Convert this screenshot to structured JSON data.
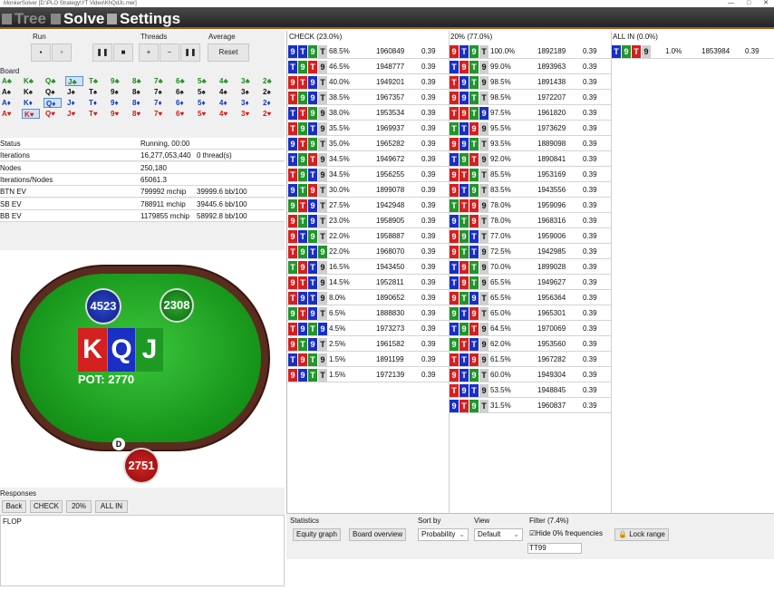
{
  "window": {
    "title": "MonkerSolver [D:\\PLO Strategy\\YT Video\\KhQdJc.mer]",
    "controls": [
      "—",
      "□",
      "✕"
    ]
  },
  "menu": [
    "Tree",
    "Solve",
    "Settings"
  ],
  "run": {
    "label": "Run",
    "threads_label": "Threads",
    "average_label": "Average",
    "reset_label": "Reset"
  },
  "board": {
    "label": "Board",
    "rows": [
      [
        [
          "A",
          "c"
        ],
        [
          "K",
          "c"
        ],
        [
          "Q",
          "c"
        ],
        [
          "J",
          "c"
        ],
        [
          "T",
          "c"
        ],
        [
          "9",
          "c"
        ],
        [
          "8",
          "c"
        ],
        [
          "7",
          "c"
        ],
        [
          "6",
          "c"
        ],
        [
          "5",
          "c"
        ],
        [
          "4",
          "c"
        ],
        [
          "3",
          "c"
        ],
        [
          "2",
          "c"
        ]
      ],
      [
        [
          "A",
          "s"
        ],
        [
          "K",
          "s"
        ],
        [
          "Q",
          "s"
        ],
        [
          "J",
          "s"
        ],
        [
          "T",
          "s"
        ],
        [
          "9",
          "s"
        ],
        [
          "8",
          "s"
        ],
        [
          "7",
          "s"
        ],
        [
          "6",
          "s"
        ],
        [
          "5",
          "s"
        ],
        [
          "4",
          "s"
        ],
        [
          "3",
          "s"
        ],
        [
          "2",
          "s"
        ]
      ],
      [
        [
          "A",
          "d"
        ],
        [
          "K",
          "d"
        ],
        [
          "Q",
          "d"
        ],
        [
          "J",
          "d"
        ],
        [
          "T",
          "d"
        ],
        [
          "9",
          "d"
        ],
        [
          "8",
          "d"
        ],
        [
          "7",
          "d"
        ],
        [
          "6",
          "d"
        ],
        [
          "5",
          "d"
        ],
        [
          "4",
          "d"
        ],
        [
          "3",
          "d"
        ],
        [
          "2",
          "d"
        ]
      ],
      [
        [
          "A",
          "h"
        ],
        [
          "K",
          "h"
        ],
        [
          "Q",
          "h"
        ],
        [
          "J",
          "h"
        ],
        [
          "T",
          "h"
        ],
        [
          "9",
          "h"
        ],
        [
          "8",
          "h"
        ],
        [
          "7",
          "h"
        ],
        [
          "6",
          "h"
        ],
        [
          "5",
          "h"
        ],
        [
          "4",
          "h"
        ],
        [
          "3",
          "h"
        ],
        [
          "2",
          "h"
        ]
      ]
    ]
  },
  "stats": [
    {
      "k": "Status",
      "v": "Running, 00:00",
      "v2": ""
    },
    {
      "k": "Iterations",
      "v": "16,277,053,440",
      "v2": "0 thread(s)"
    },
    {
      "k": "Nodes",
      "v": "250,180",
      "v2": ""
    },
    {
      "k": "Iterations/Nodes",
      "v": "65061.3",
      "v2": ""
    },
    {
      "k": "BTN EV",
      "v": "799992 mchip",
      "v2": "39999.6 bb/100"
    },
    {
      "k": "SB EV",
      "v": "788911 mchip",
      "v2": "39445.6 bb/100"
    },
    {
      "k": "BB EV",
      "v": "1179855 mchip",
      "v2": "58992.8 bb/100"
    }
  ],
  "table": {
    "stacks": [
      "4523",
      "2308",
      "2751"
    ],
    "board_cards": [
      "K",
      "Q",
      "J"
    ],
    "pot": "POT: 2770",
    "dealer": "D"
  },
  "responses": {
    "label": "Responses",
    "buttons": [
      "Back",
      "CHECK",
      "20%",
      "ALL IN"
    ],
    "history": "FLOP"
  },
  "columns": [
    {
      "title": "CHECK (23.0%)",
      "rows": [
        [
          "9bT b9gT k",
          "68.5%",
          "1960849",
          "0.39"
        ],
        [
          "T b9gT r9k",
          "46.5%",
          "1948777",
          "0.39"
        ],
        [
          "9r T r9b T k",
          "40.0%",
          "1949201",
          "0.39"
        ],
        [
          "T r9g9bT k",
          "38.5%",
          "1967357",
          "0.39"
        ],
        [
          "T b T r9g9k",
          "38.0%",
          "1953534",
          "0.39"
        ],
        [
          "T r9gT b9k",
          "35.5%",
          "1969937",
          "0.39"
        ],
        [
          "9bT r9g T k",
          "35.0%",
          "1965282",
          "0.39"
        ],
        [
          "T b9gT r9k",
          "34.5%",
          "1949672",
          "0.39"
        ],
        [
          "T r9g T b9k",
          "34.5%",
          "1956255",
          "0.39"
        ],
        [
          "9bT g9r T k",
          "30.0%",
          "1899078",
          "0.39"
        ],
        [
          "9gT r9b T k",
          "27.5%",
          "1942948",
          "0.39"
        ],
        [
          "9r T g9b T k",
          "23.0%",
          "1958905",
          "0.39"
        ],
        [
          "9r T b9g T k",
          "22.0%",
          "1958887",
          "0.39"
        ],
        [
          "T r9gT b9g",
          "22.0%",
          "1968070",
          "0.39"
        ],
        [
          "T g9rT b9k",
          "16.5%",
          "1943450",
          "0.39"
        ],
        [
          "9r T rT b9k",
          "14.5%",
          "1952811",
          "0.39"
        ],
        [
          "T r9bT b9k",
          "8.0%",
          "1890652",
          "0.39"
        ],
        [
          "9gT r9b T k",
          "6.5%",
          "1888830",
          "0.39"
        ],
        [
          "T r9bT g9b",
          "4.5%",
          "1973273",
          "0.39"
        ],
        [
          "9r T g9b T k",
          "2.5%",
          "1961582",
          "0.39"
        ],
        [
          "T b9rT g9k",
          "1.5%",
          "1891199",
          "0.39"
        ],
        [
          "9r9bT gT k",
          "1.5%",
          "1972139",
          "0.39"
        ]
      ]
    },
    {
      "title": "20% (77.0%)",
      "rows": [
        [
          "9r T b9g T k",
          "100.0%",
          "1892189",
          "0.39"
        ],
        [
          "T b9rT g9k",
          "99.0%",
          "1893963",
          "0.39"
        ],
        [
          "T r9bT g9k",
          "98.5%",
          "1891438",
          "0.39"
        ],
        [
          "9r9bT gT k",
          "98.5%",
          "1972207",
          "0.39"
        ],
        [
          "T r9rT g9b",
          "97.5%",
          "1961820",
          "0.39"
        ],
        [
          "T gT b9r9k",
          "95.5%",
          "1973629",
          "0.39"
        ],
        [
          "9r9bT gT k",
          "93.5%",
          "1889098",
          "0.39"
        ],
        [
          "T b9gT r9k",
          "92.0%",
          "1890841",
          "0.39"
        ],
        [
          "9r T r9g T k",
          "85.5%",
          "1953169",
          "0.39"
        ],
        [
          "9r T b9g T k",
          "83.5%",
          "1943556",
          "0.39"
        ],
        [
          "T gT r9r9k",
          "78.0%",
          "1959096",
          "0.39"
        ],
        [
          "9bT g9r T k",
          "78.0%",
          "1968316",
          "0.39"
        ],
        [
          "9r9gT bT k",
          "77.0%",
          "1959006",
          "0.39"
        ],
        [
          "9rT gT b9k",
          "72.5%",
          "1942985",
          "0.39"
        ],
        [
          "T b9rT g9k",
          "70.0%",
          "1899028",
          "0.39"
        ],
        [
          "T b9rT g9k",
          "65.5%",
          "1949627",
          "0.39"
        ],
        [
          "9r T g9b T k",
          "65.5%",
          "1956364",
          "0.39"
        ],
        [
          "9gT b9r T k",
          "65.0%",
          "1965301",
          "0.39"
        ],
        [
          "T b9gT r9k",
          "64.5%",
          "1970069",
          "0.39"
        ],
        [
          "9gT rT b9k",
          "62.0%",
          "1953560",
          "0.39"
        ],
        [
          "T rT b9r9k",
          "61.5%",
          "1967282",
          "0.39"
        ],
        [
          "9r T b9g T k",
          "60.0%",
          "1949304",
          "0.39"
        ],
        [
          "T r9bT b9k",
          "53.5%",
          "1948845",
          "0.39"
        ],
        [
          "9bT r9g T k",
          "31.5%",
          "1960837",
          "0.39"
        ]
      ]
    },
    {
      "title": "ALL IN (0.0%)",
      "rows": [
        [
          "T b9gT r9k",
          "1.0%",
          "1853984",
          "0.39"
        ]
      ]
    }
  ],
  "bottom": {
    "statistics_label": "Statistics",
    "equity_graph": "Equity graph",
    "board_overview": "Board overview",
    "sortby_label": "Sort by",
    "sortby_value": "Probability",
    "view_label": "View",
    "view_value": "Default",
    "filter_label": "Filter (7.4%)",
    "hide_label": "Hide 0% frequencies",
    "lock_label": "Lock range",
    "filter_input": "TT99"
  }
}
